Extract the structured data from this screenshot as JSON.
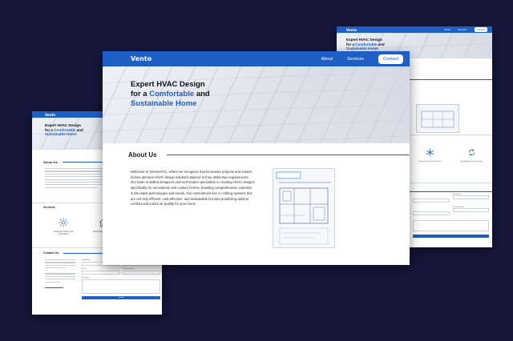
{
  "brand": {
    "logo": "Vento",
    "accent": "#1d5fc4",
    "background": "#16173a"
  },
  "nav": {
    "about": "About",
    "services": "Services",
    "contact": "Contact"
  },
  "hero": {
    "line1": "Expert HVAC Design",
    "line2_prefix": "for a ",
    "line2_highlight": "Comfortable",
    "line2_suffix": " and",
    "line3": "Sustainable Home"
  },
  "about": {
    "title": "About Us",
    "body": "Welcome to VentoHVAC, where we recognize that innovative projects and custom homes demand HVAC design solutions tailored to their distinctive requirements. Our team of skilled designers and technicians specializes in creating HVAC designs specifically for renovations and custom homes, boasting comprehensive expertise in the latest technologies and trends. Our commitment lies in crafting systems that are not only efficient, cost-effective, and sustainable but also prioritizing optimal comfort and indoor air quality for your home."
  },
  "services": {
    "title": "Services",
    "items": [
      {
        "icon": "sun-icon",
        "label": "Heating & Cooling Load Calculations"
      },
      {
        "icon": "house-icon",
        "label": "Residential HVAC Design"
      }
    ],
    "right_items": [
      {
        "icon": "snowflake-icon",
        "label": "Residential Mechanical Plans"
      },
      {
        "icon": "recycle-icon",
        "label": "Energy Efficiency Consulting"
      }
    ]
  },
  "contact": {
    "title": "Contact Us",
    "intro": "Whether you are embarking on a new construction project or planning a renovation, reach out to discuss your HVAC design needs.",
    "fields": {
      "first_name": "First Name",
      "last_name": "Last Name",
      "email": "Email",
      "phone": "Phone Number",
      "message": "Message",
      "submit": "Submit"
    }
  }
}
